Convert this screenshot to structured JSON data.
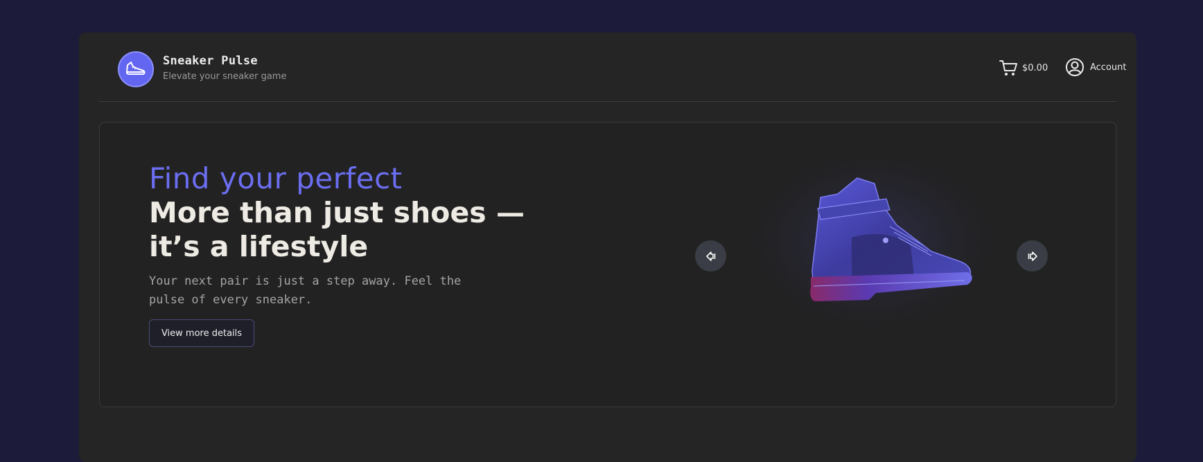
{
  "brand": {
    "name": "Sneaker Pulse",
    "tagline": "Elevate your sneaker game",
    "logo_icon": "sneaker-icon",
    "accent_color": "#6366f1"
  },
  "nav": {
    "cart_icon": "cart-icon",
    "cart_total": "$0.00",
    "account_icon": "user-circle-icon",
    "account_label": "Account"
  },
  "hero": {
    "eyebrow": "Find your perfect",
    "headline": "More than just shoes — it’s a lifestyle",
    "subtext": "Your next pair is just a step away. Feel the pulse of every sneaker.",
    "cta_label": "View more details",
    "prev_icon": "arrow-left-icon",
    "next_icon": "arrow-right-icon",
    "image_icon": "high-top-sneaker-image"
  }
}
